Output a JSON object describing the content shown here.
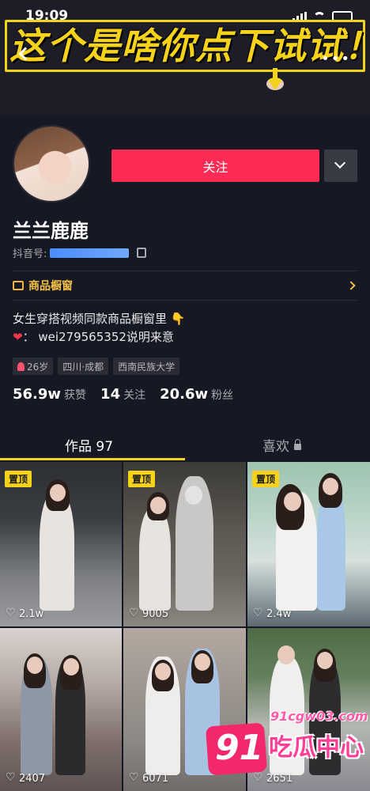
{
  "status_bar": {
    "time": "19:09"
  },
  "banner": {
    "headline": "这个是啥你点下试试！"
  },
  "profile": {
    "follow_label": "关注",
    "username": "兰兰鹿鹿",
    "douyin_id_label": "抖音号:",
    "shop_window_label": "商品橱窗",
    "bio_line1": "女生穿搭视频同款商品橱窗里 👇",
    "bio_line2": "：  wei279565352说明来意",
    "tags": [
      "26岁",
      "四川·成都",
      "西南民族大学"
    ],
    "stats": [
      {
        "value": "56.9w",
        "label": "获赞"
      },
      {
        "value": "14",
        "label": "关注"
      },
      {
        "value": "20.6w",
        "label": "粉丝"
      }
    ]
  },
  "tabs": {
    "works": "作品 97",
    "likes": "喜欢"
  },
  "videos": [
    {
      "pinned": "置顶",
      "likes": "2.1w"
    },
    {
      "pinned": "置顶",
      "likes": "9005"
    },
    {
      "pinned": "置顶",
      "likes": "2.4w"
    },
    {
      "pinned": "",
      "likes": "2407"
    },
    {
      "pinned": "",
      "likes": "6071"
    },
    {
      "pinned": "",
      "likes": "2651"
    }
  ],
  "watermark": {
    "number": "91",
    "url": "91cgw03.com",
    "text": "吃瓜中心"
  },
  "colors": {
    "accent": "#fe2c55",
    "highlight": "#f6d31a",
    "background": "#161823"
  }
}
